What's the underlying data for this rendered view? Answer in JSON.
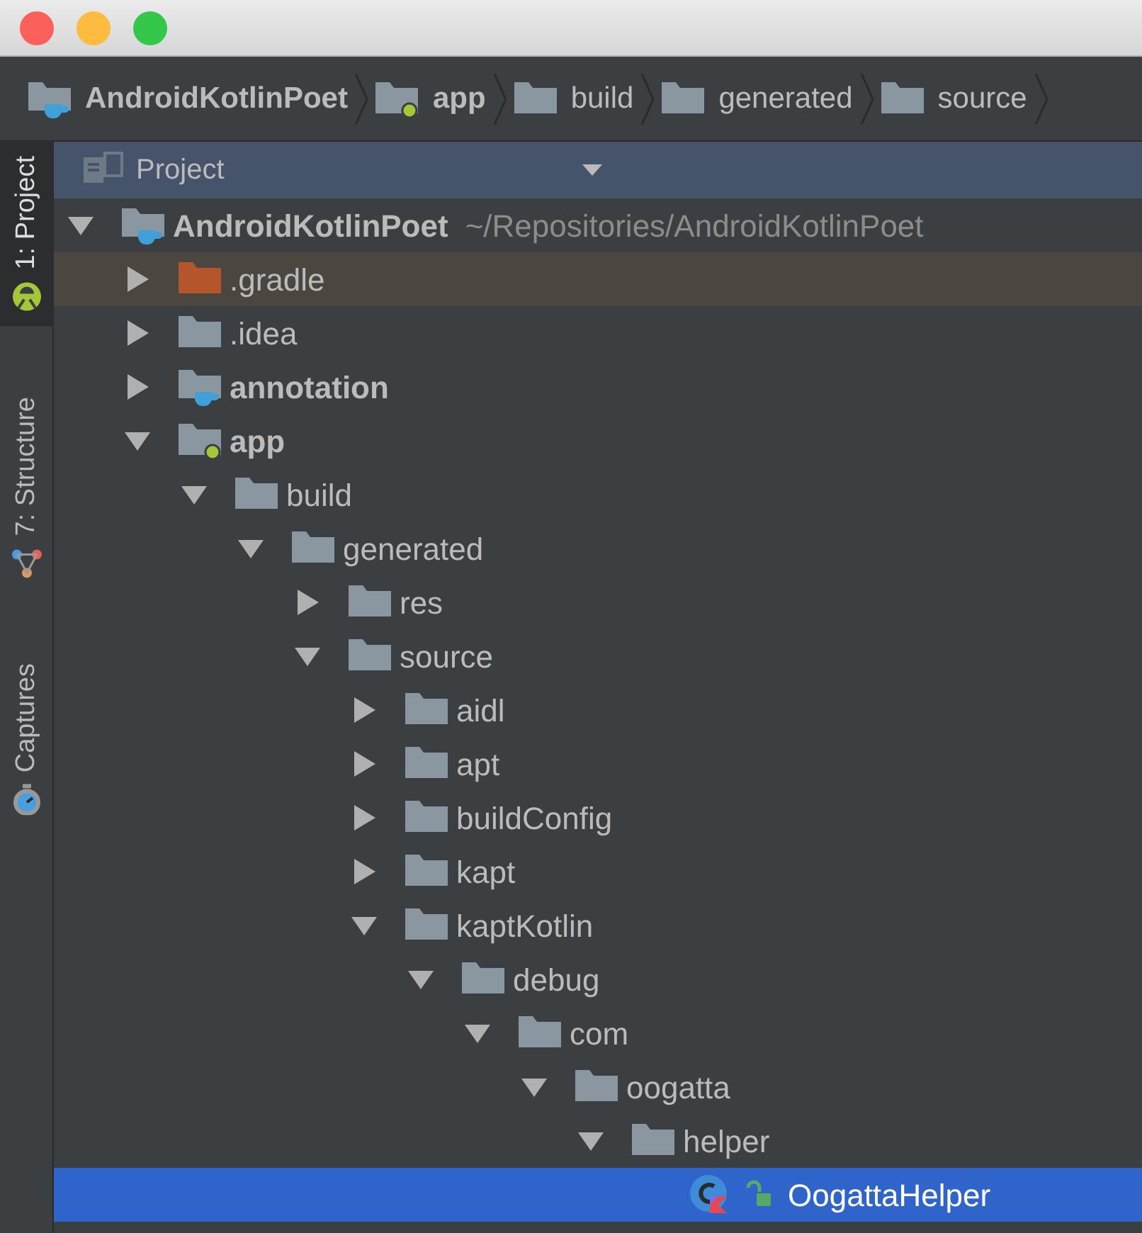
{
  "window": {
    "controls": [
      {
        "kind": "close"
      },
      {
        "kind": "minimize"
      },
      {
        "kind": "zoom"
      }
    ]
  },
  "breadcrumbs": [
    {
      "label": "AndroidKotlinPoet",
      "kind": "module"
    },
    {
      "label": "app",
      "kind": "android-module"
    },
    {
      "label": "build",
      "kind": "folder"
    },
    {
      "label": "generated",
      "kind": "folder"
    },
    {
      "label": "source",
      "kind": "folder"
    }
  ],
  "side_tabs": [
    {
      "label": "1: Project",
      "kind": "android",
      "selected": true
    },
    {
      "label": "7: Structure",
      "kind": "structure",
      "selected": false
    },
    {
      "label": "Captures",
      "kind": "captures",
      "selected": false
    }
  ],
  "panel": {
    "title": "Project"
  },
  "tree": [
    {
      "label": "AndroidKotlinPoet",
      "path": "~/Repositories/AndroidKotlinPoet",
      "kind": "module",
      "expanded": true,
      "selected": false,
      "children": [
        {
          "label": ".gradle",
          "kind": "excluded",
          "expanded": false,
          "selected": false
        },
        {
          "label": ".idea",
          "kind": "folder",
          "expanded": false,
          "selected": false
        },
        {
          "label": "annotation",
          "kind": "module",
          "expanded": false,
          "selected": false
        },
        {
          "label": "app",
          "kind": "android-module",
          "expanded": true,
          "selected": false,
          "children": [
            {
              "label": "build",
              "kind": "folder",
              "expanded": true,
              "selected": false,
              "children": [
                {
                  "label": "generated",
                  "kind": "folder",
                  "expanded": true,
                  "selected": false,
                  "children": [
                    {
                      "label": "res",
                      "kind": "folder",
                      "expanded": false,
                      "selected": false
                    },
                    {
                      "label": "source",
                      "kind": "folder",
                      "expanded": true,
                      "selected": false,
                      "children": [
                        {
                          "label": "aidl",
                          "kind": "folder",
                          "expanded": false,
                          "selected": false
                        },
                        {
                          "label": "apt",
                          "kind": "folder",
                          "expanded": false,
                          "selected": false
                        },
                        {
                          "label": "buildConfig",
                          "kind": "folder",
                          "expanded": false,
                          "selected": false
                        },
                        {
                          "label": "kapt",
                          "kind": "folder",
                          "expanded": false,
                          "selected": false
                        },
                        {
                          "label": "kaptKotlin",
                          "kind": "folder",
                          "expanded": true,
                          "selected": false,
                          "children": [
                            {
                              "label": "debug",
                              "kind": "folder",
                              "expanded": true,
                              "selected": false,
                              "children": [
                                {
                                  "label": "com",
                                  "kind": "folder",
                                  "expanded": true,
                                  "selected": false,
                                  "children": [
                                    {
                                      "label": "oogatta",
                                      "kind": "folder",
                                      "expanded": true,
                                      "selected": false,
                                      "children": [
                                        {
                                          "label": "helper",
                                          "kind": "folder",
                                          "expanded": true,
                                          "selected": false,
                                          "children": [
                                            {
                                              "label": "OogattaHelper",
                                              "kind": "class",
                                              "selected": true
                                            }
                                          ]
                                        }
                                      ]
                                    }
                                  ]
                                }
                              ]
                            }
                          ]
                        }
                      ]
                    }
                  ]
                }
              ]
            }
          ]
        }
      ]
    }
  ]
}
